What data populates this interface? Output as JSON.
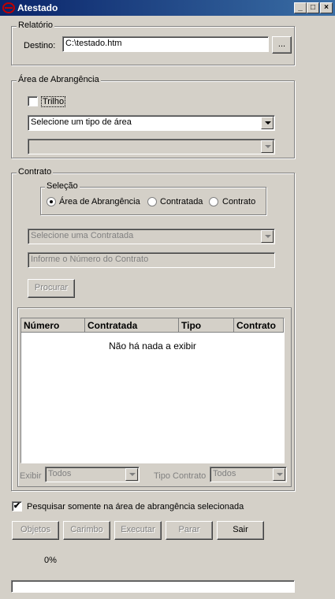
{
  "window": {
    "title": "Atestado",
    "minimize": "_",
    "maximize": "□",
    "close": "×"
  },
  "relatorio": {
    "legend": "Relatório",
    "destino_label": "Destino:",
    "destino_value": "C:\\testado.htm",
    "browse_label": "..."
  },
  "area": {
    "legend": "Área de Abrangência",
    "trilho_label": "Trilho",
    "trilho_checked": false,
    "tipo_area": "Selecione um tipo de área",
    "sub_area": ""
  },
  "contrato": {
    "legend": "Contrato",
    "selecao_legend": "Seleção",
    "radios": [
      {
        "label": "Área de Abrangência",
        "checked": true
      },
      {
        "label": "Contratada",
        "checked": false
      },
      {
        "label": "Contrato",
        "checked": false
      }
    ],
    "contratada_select": "Selecione uma Contratada",
    "numero_placeholder": "Informe o Número do Contrato",
    "procurar_label": "Procurar",
    "table": {
      "columns": [
        "Número",
        "Contratada",
        "Tipo",
        "Contrato"
      ],
      "empty_text": "Não há nada a exibir"
    },
    "exibir_label": "Exibir",
    "exibir_value": "Todos",
    "tipo_contrato_label": "Tipo Contrato",
    "tipo_contrato_value": "Todos"
  },
  "pesquisar": {
    "label": "Pesquisar somente na área de abrangência selecionada",
    "checked": true,
    "mark": "✔"
  },
  "buttons": {
    "objetos": "Objetos",
    "carimbo": "Carimbo",
    "executar": "Executar",
    "parar": "Parar",
    "sair": "Sair"
  },
  "progress": {
    "text": "0%",
    "value": 0
  }
}
